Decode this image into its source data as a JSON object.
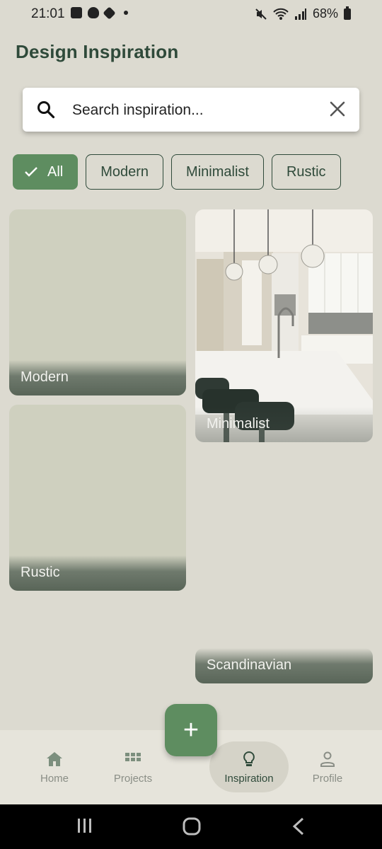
{
  "status_bar": {
    "time": "21:01",
    "battery": "68%",
    "icons": [
      "image-icon",
      "snapchat-icon",
      "tag-icon",
      "notification-dot",
      "mute-icon",
      "wifi-icon",
      "signal-icon",
      "battery-icon"
    ]
  },
  "header": {
    "title": "Design Inspiration"
  },
  "search": {
    "placeholder": "Search inspiration...",
    "value": ""
  },
  "filters": [
    {
      "label": "All",
      "selected": true
    },
    {
      "label": "Modern",
      "selected": false
    },
    {
      "label": "Minimalist",
      "selected": false
    },
    {
      "label": "Rustic",
      "selected": false
    }
  ],
  "cards": [
    {
      "label": "Modern"
    },
    {
      "label": "Minimalist"
    },
    {
      "label": "Rustic"
    },
    {
      "label": "Scandinavian"
    }
  ],
  "fab": {
    "label": "+"
  },
  "nav": [
    {
      "label": "Home",
      "icon": "home-icon"
    },
    {
      "label": "Projects",
      "icon": "grid-icon"
    },
    {
      "label": "Inspiration",
      "icon": "lightbulb-icon",
      "active": true
    },
    {
      "label": "Profile",
      "icon": "person-icon"
    }
  ],
  "colors": {
    "background": "#dcdad0",
    "accent": "#5e8d60",
    "title": "#2f4a3a",
    "card_placeholder": "#cfd0bf"
  }
}
